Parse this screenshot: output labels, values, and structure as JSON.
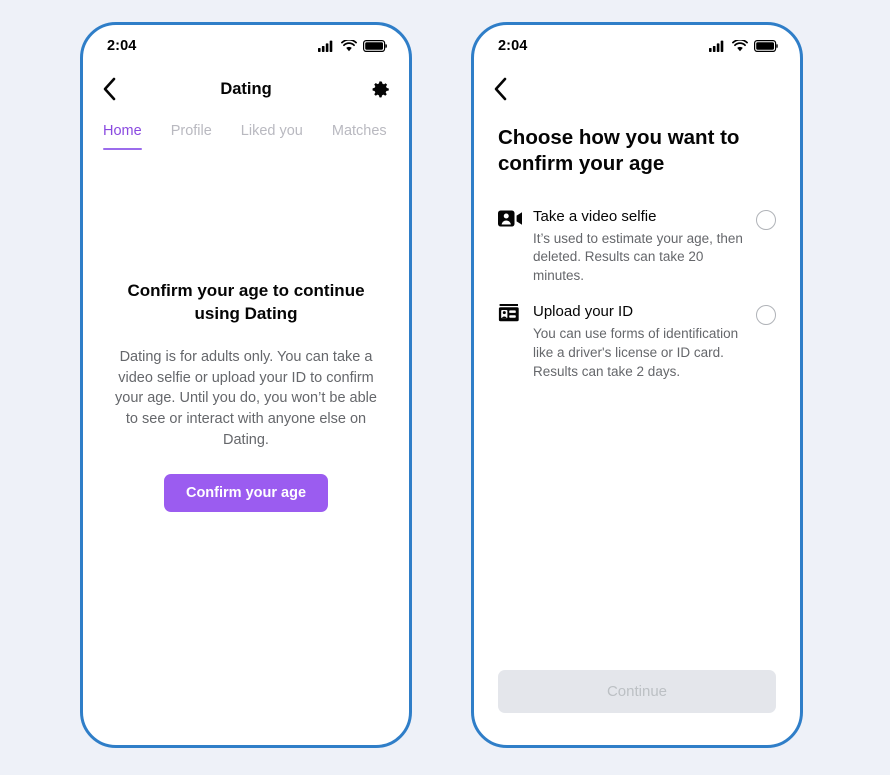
{
  "theme": {
    "page_background": "#eef1f8",
    "phone_border": "#2f7ec8",
    "accent_purple": "#9b5cf0",
    "tab_active": "#8a4ae0",
    "muted_text": "#65676b",
    "disabled_button_bg": "#e4e6eb",
    "disabled_button_text": "#bcc0c4"
  },
  "left_screen": {
    "status_bar": {
      "time": "2:04",
      "icons": [
        "signal-icon",
        "wifi-icon",
        "battery-icon"
      ]
    },
    "nav": {
      "back_icon": "chevron-left-icon",
      "title": "Dating",
      "settings_icon": "gear-icon"
    },
    "tabs": [
      {
        "label": "Home",
        "active": true
      },
      {
        "label": "Profile",
        "active": false
      },
      {
        "label": "Liked you",
        "active": false
      },
      {
        "label": "Matches",
        "active": false
      }
    ],
    "content": {
      "title": "Confirm your age to continue using Dating",
      "description": "Dating is for adults only. You can take a video selfie or upload your ID to confirm your age. Until you do, you won’t be able to see or interact with anyone else on Dating.",
      "cta_label": "Confirm your age"
    }
  },
  "right_screen": {
    "status_bar": {
      "time": "2:04",
      "icons": [
        "signal-icon",
        "wifi-icon",
        "battery-icon"
      ]
    },
    "nav": {
      "back_icon": "chevron-left-icon"
    },
    "content": {
      "title": "Choose how you want to confirm your age",
      "options": [
        {
          "icon": "video-selfie-icon",
          "label": "Take a video selfie",
          "description": "It’s used to estimate your age, then deleted. Results can take 20 minutes.",
          "selected": false
        },
        {
          "icon": "id-card-icon",
          "label": "Upload your ID",
          "description": "You can use forms of identification like a driver's license or ID card. Results can take 2 days.",
          "selected": false
        }
      ],
      "continue_label": "Continue",
      "continue_enabled": false
    }
  }
}
